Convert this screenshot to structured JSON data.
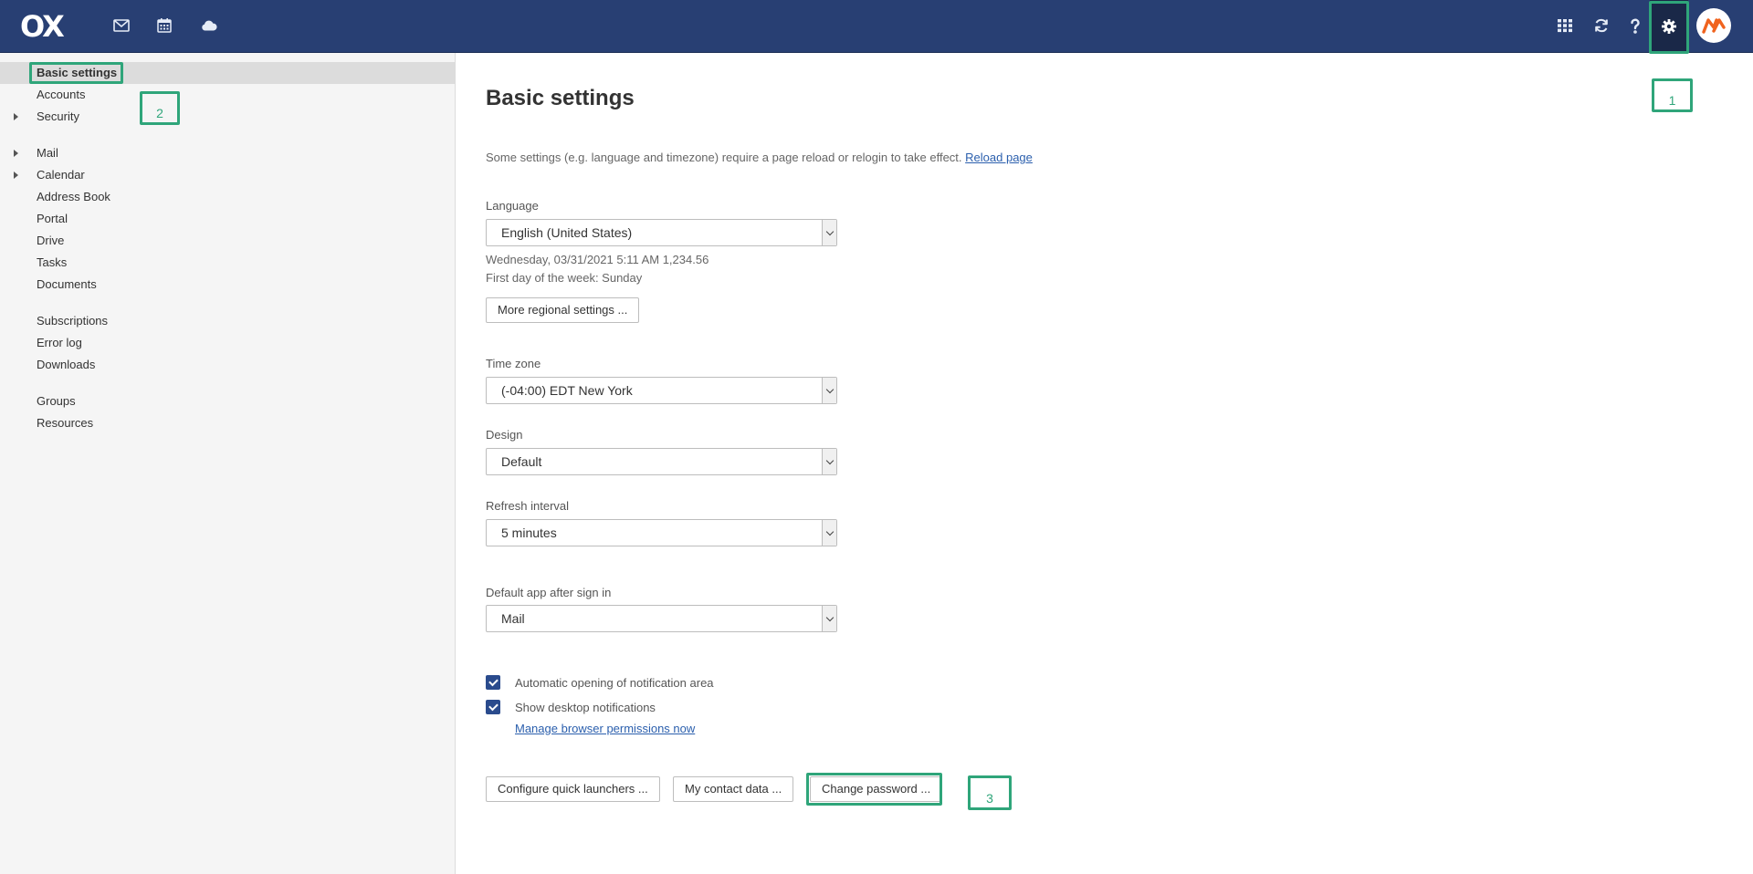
{
  "topbar": {
    "logo": "OX",
    "icons": [
      "mail-icon",
      "calendar-icon",
      "cloud-icon",
      "apps-grid-icon",
      "refresh-icon",
      "help-icon",
      "settings-gear-icon"
    ],
    "colors": {
      "bar": "#283f73",
      "active": "#1a2848",
      "accent": "#f0631e"
    }
  },
  "sidebar": {
    "items": [
      {
        "label": "Basic settings"
      },
      {
        "label": "Accounts"
      },
      {
        "label": "Security"
      },
      {
        "label": "Mail"
      },
      {
        "label": "Calendar"
      },
      {
        "label": "Address Book"
      },
      {
        "label": "Portal"
      },
      {
        "label": "Drive"
      },
      {
        "label": "Tasks"
      },
      {
        "label": "Documents"
      },
      {
        "label": "Subscriptions"
      },
      {
        "label": "Error log"
      },
      {
        "label": "Downloads"
      },
      {
        "label": "Groups"
      },
      {
        "label": "Resources"
      }
    ]
  },
  "main": {
    "title": "Basic settings",
    "hint": "Some settings (e.g. language and timezone) require a page reload or relogin to take effect.",
    "reload_link": "Reload page",
    "language": {
      "label": "Language",
      "value": "English (United States)"
    },
    "date_preview": "Wednesday, 03/31/2021 5:11 AM   1,234.56",
    "week_start": "First day of the week: Sunday",
    "regional_button": "More regional settings ...",
    "timezone": {
      "label": "Time zone",
      "value": "(-04:00) EDT New York"
    },
    "design": {
      "label": "Design",
      "value": "Default"
    },
    "refresh": {
      "label": "Refresh interval",
      "value": "5 minutes"
    },
    "default_app": {
      "label": "Default app after sign in",
      "value": "Mail"
    },
    "checkboxes": [
      {
        "label": "Automatic opening of notification area",
        "checked": true
      },
      {
        "label": "Show desktop notifications",
        "checked": true
      }
    ],
    "permissions_link": "Manage browser permissions now",
    "buttons": {
      "quick_launchers": "Configure quick launchers ...",
      "contact_data": "My contact data ...",
      "change_password": "Change password ..."
    }
  },
  "annotations": {
    "one": "1",
    "two": "2",
    "three": "3"
  }
}
